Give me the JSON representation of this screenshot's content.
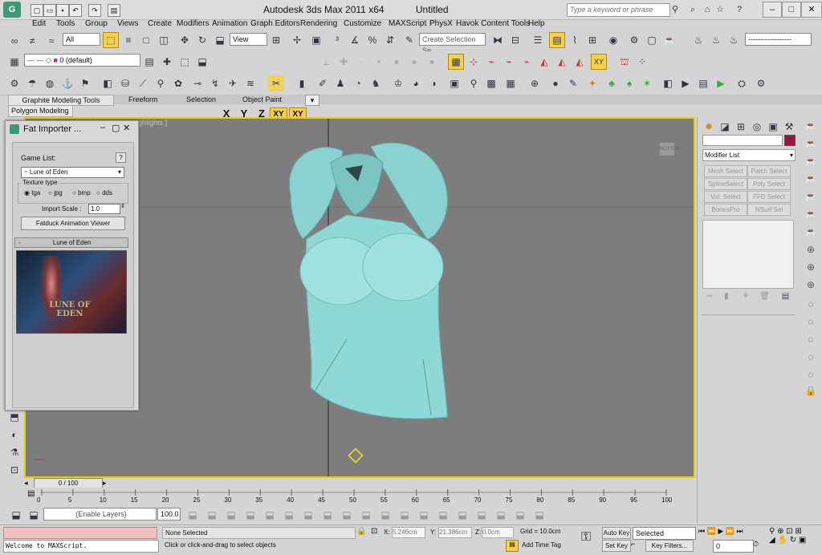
{
  "app": {
    "title": "Autodesk 3ds Max  2011 x64",
    "document": "Untitled",
    "search_placeholder": "Type a keyword or phrase"
  },
  "menu": [
    "Edit",
    "Tools",
    "Group",
    "Views",
    "Create",
    "Modifiers",
    "Animation",
    "Graph Editors",
    "Rendering",
    "Customize",
    "MAXScript",
    "PhysX",
    "Havok Content Tools",
    "Help"
  ],
  "toolbar": {
    "filter_value": "All",
    "view_value": "View",
    "selection_set_placeholder": "Create Selection Se",
    "layer_value": "0 (default)",
    "axis_x": "X",
    "axis_y": "Y",
    "axis_z": "Z",
    "axis_xy": "XY",
    "axis_xy2": "XY"
  },
  "ribbon": {
    "tabs": [
      "Graphite Modeling Tools",
      "Freeform",
      "Selection",
      "Object Paint"
    ],
    "panel": "Polygon Modeling"
  },
  "viewport": {
    "label": "[ + ] [ Perspective ] [ Smooth + Highlights ]",
    "cube_label": "BOTTOM"
  },
  "fat_importer": {
    "title": "Fat Importer ...",
    "game_list_label": "Game List:",
    "help": "?",
    "game_value": "~ Lune of Eden",
    "texture_type_label": "Texture type",
    "texture_options": [
      "tga",
      "jpg",
      "bmp",
      "dds"
    ],
    "selected_texture": "tga",
    "import_scale_label": "Import Scale :",
    "import_scale_value": "1.0",
    "viewer_button": "Fatduck Animation Viewer",
    "rollout_toggle": "-",
    "rollout_title": "Lune of Eden",
    "banner_text": "LUNE OF EDEN"
  },
  "command_panel": {
    "modifier_list": "Modifier List",
    "buttons": [
      "Mesh Select",
      "Patch Select",
      "SplineSelect",
      "Poly Select",
      "Vol. Select",
      "FFD Select",
      "BonesPro",
      "NSurf Sel"
    ]
  },
  "timeline": {
    "frame_display": "0 / 100",
    "ticks": [
      "0",
      "5",
      "10",
      "15",
      "20",
      "25",
      "30",
      "35",
      "40",
      "45",
      "50",
      "55",
      "60",
      "65",
      "70",
      "75",
      "80",
      "85",
      "90",
      "95",
      "100"
    ]
  },
  "layers": {
    "layer_dropdown": "(Enable Layers)",
    "percent": "100.0"
  },
  "status": {
    "maxscript_line": "Welcome to MAXScript.",
    "selection": "None Selected",
    "prompt": "Click or click-and-drag to select objects",
    "x_label": "X:",
    "x_value": "5.246cm",
    "y_label": "Y:",
    "y_value": "21.386cm",
    "z_label": "Z:",
    "z_value": "0.0cm",
    "grid": "Grid = 10.0cm",
    "add_time_tag": "Add Time Tag",
    "auto_key": "Auto Key",
    "set_key": "Set Key",
    "selected_value": "Selected",
    "key_filters": "Key Filters...",
    "frame": "0"
  },
  "colors": {
    "viewport_bg": "#7d7d7d",
    "active_border": "#e7d000",
    "model": "#8ed8d6",
    "active_button": "#f6d04a"
  }
}
